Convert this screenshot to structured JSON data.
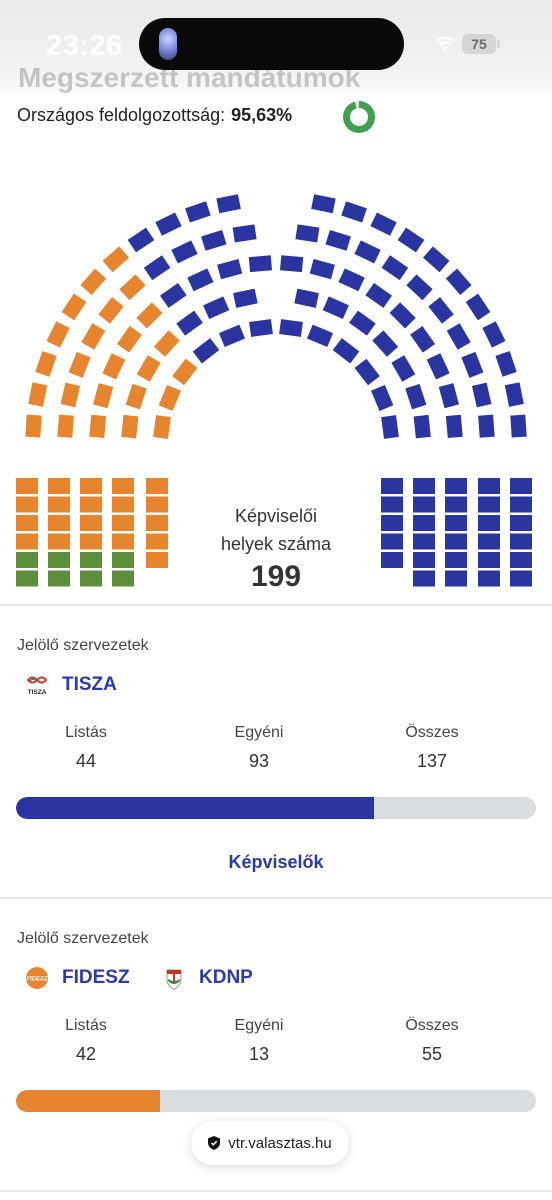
{
  "status_bar": {
    "time": "23:26",
    "battery": "75"
  },
  "header": {
    "title_partial": "Megszerzett mandátumok"
  },
  "processing": {
    "label": "Országos feldolgozottság:",
    "value": "95,63%",
    "fraction": 0.9563
  },
  "hemicycle": {
    "label_line1": "Képviselői",
    "label_line2": "helyek száma",
    "total": "199",
    "colors": {
      "tisza": "#2a35a2",
      "fidesz": "#e6852e",
      "mi_hazank": "#5e8e3a"
    }
  },
  "cards": [
    {
      "caption": "Jelölő szervezetek",
      "parties": [
        {
          "name": "TISZA",
          "logo_text": "TISZA",
          "icon": "tisza-logo-icon"
        }
      ],
      "stats": [
        {
          "label": "Listás",
          "value": "44"
        },
        {
          "label": "Egyéni",
          "value": "93"
        },
        {
          "label": "Összes",
          "value": "137"
        }
      ],
      "bar_fraction": 0.6884,
      "bar_color": "#2a35a2",
      "link": "Képviselők"
    },
    {
      "caption": "Jelölő szervezetek",
      "parties": [
        {
          "name": "FIDESZ",
          "logo_text": "FIDESZ",
          "icon": "fidesz-logo-icon"
        },
        {
          "name": "KDNP",
          "icon": "kdnp-logo-icon"
        }
      ],
      "stats": [
        {
          "label": "Listás",
          "value": "42"
        },
        {
          "label": "Egyéni",
          "value": "13"
        },
        {
          "label": "Összes",
          "value": "55"
        }
      ],
      "bar_fraction": 0.2764,
      "bar_color": "#e6852e",
      "link": "Képviselők"
    }
  ],
  "browser": {
    "url": "vtr.valasztas.hu"
  }
}
